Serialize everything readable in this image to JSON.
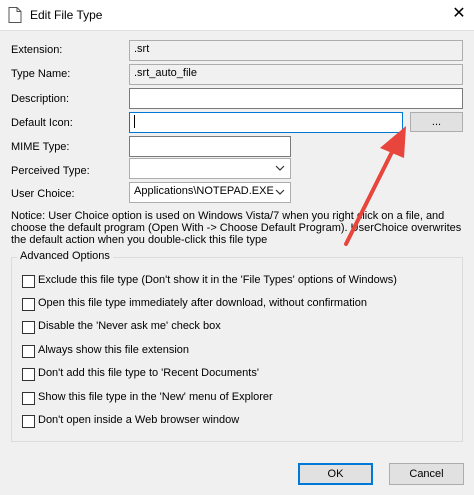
{
  "window": {
    "title": "Edit File Type",
    "close_glyph": "✕"
  },
  "fields": {
    "extension": {
      "label": "Extension:",
      "value": ".srt"
    },
    "type_name": {
      "label": "Type Name:",
      "value": ".srt_auto_file"
    },
    "description": {
      "label": "Description:",
      "value": ""
    },
    "default_icon": {
      "label": "Default Icon:",
      "value": "",
      "browse_label": "..."
    },
    "mime_type": {
      "label": "MIME Type:",
      "value": ""
    },
    "perceived_type": {
      "label": "Perceived Type:",
      "value": ""
    },
    "user_choice": {
      "label": "User Choice:",
      "value": "Applications\\NOTEPAD.EXE"
    }
  },
  "notice": "Notice: User Choice option is used on Windows Vista/7 when you right click on a file, and choose the default program (Open With -> Choose Default Program). UserChoice overwrites the default action when you double-click this file type",
  "advanced": {
    "title": "Advanced Options",
    "options": [
      {
        "label": "Exclude  this file type (Don't show it in the 'File Types' options of Windows)",
        "checked": false
      },
      {
        "label": "Open this file type immediately after download, without confirmation",
        "checked": false
      },
      {
        "label": "Disable the 'Never ask me' check box",
        "checked": false
      },
      {
        "label": "Always show this file extension",
        "checked": false
      },
      {
        "label": "Don't add this file type to 'Recent Documents'",
        "checked": false
      },
      {
        "label": "Show this file type in the 'New' menu of Explorer",
        "checked": false
      },
      {
        "label": "Don't open inside a Web browser window",
        "checked": false
      }
    ]
  },
  "buttons": {
    "ok": "OK",
    "cancel": "Cancel"
  },
  "colors": {
    "accent": "#0078d7",
    "arrow": "#e8453c"
  }
}
